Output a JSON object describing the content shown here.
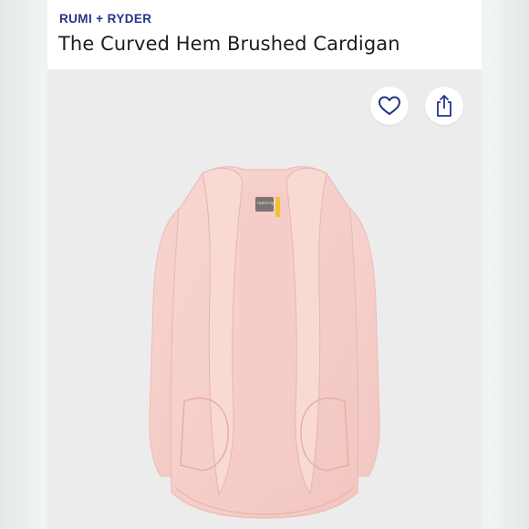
{
  "product": {
    "brand": "RUMI + RYDER",
    "title": "The Curved Hem Brushed Cardigan",
    "tag_brand": "rumi+ryder"
  },
  "actions": {
    "favorite_icon": "heart-outline-icon",
    "share_icon": "share-icon"
  },
  "colors": {
    "brand_text": "#24348a",
    "background": "#ececec",
    "garment": "#f6cfca",
    "garment_shadow": "#eab7b1",
    "size_tag": "#7a7572",
    "accent_tag": "#f1c232"
  }
}
